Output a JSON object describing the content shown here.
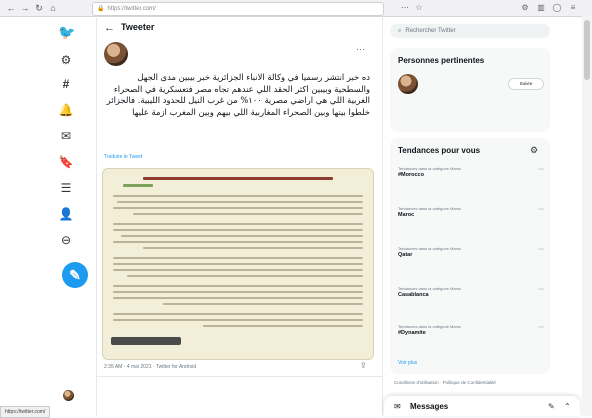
{
  "browser": {
    "url": "https://twitter.com/",
    "status_url": "https://twitter.com/"
  },
  "nav": {
    "items": [
      {
        "name": "twitter-logo-icon",
        "glyph": "🐦"
      },
      {
        "name": "settings-icon",
        "glyph": "⚙"
      },
      {
        "name": "explore-hashtag-icon",
        "glyph": "#"
      },
      {
        "name": "notifications-icon",
        "glyph": "🔔"
      },
      {
        "name": "messages-icon",
        "glyph": "✉"
      },
      {
        "name": "bookmarks-icon",
        "glyph": "🔖"
      },
      {
        "name": "lists-icon",
        "glyph": "☰"
      },
      {
        "name": "profile-icon",
        "glyph": "👤"
      },
      {
        "name": "more-icon",
        "glyph": "⊖"
      }
    ],
    "compose_glyph": "✎"
  },
  "header": {
    "back": "←",
    "title": "Tweeter"
  },
  "tweet": {
    "author_name": "",
    "author_handle": "",
    "text": "ده خبر انتشر رسميا في وكالة الانباء الجزائرية خبر بيبين مدى الجهل والسطحية وبيبين اكثر الحقد اللي عندهم تجاه مصر فتعسكرية في الصحراء الغربية اللي هي اراضي مصرية ١٠٠% من غرب النيل للحدود الليبية. فالجزائر خلطوا بينها وبين الصحراء المغاربية اللي بيهم وبين المغرب ازمة عليها",
    "translate_label": "Traduire le Tweet",
    "timestamp": "2:35 AM · 4 mai 2021 · Twitter for Android",
    "stats": {
      "retweets": "",
      "quotes": "",
      "likes": ""
    }
  },
  "right": {
    "search_placeholder": "Rechercher Twitter",
    "relevant_title": "Personnes pertinentes",
    "relevant_name": "",
    "relevant_handle": "",
    "follow_label": "Suivre",
    "relevant_bio": "",
    "trends_title": "Tendances pour vous",
    "trends": [
      {
        "category": "Tendances dans la catégorie Maroc",
        "name": "#Morocco",
        "count": ""
      },
      {
        "category": "Tendances dans la catégorie Maroc",
        "name": "Maroc",
        "count": ""
      },
      {
        "category": "Tendances dans la catégorie Maroc",
        "name": "Qatar",
        "count": ""
      },
      {
        "category": "Tendances dans la catégorie Maroc",
        "name": "Casablanca",
        "count": ""
      },
      {
        "category": "Tendances dans la catégorie Maroc",
        "name": "#Dynamite",
        "count": ""
      }
    ],
    "show_more": "Voir plus",
    "footer": "Conditions d'utilisation · Politique de Confidentialité",
    "messages_label": "Messages"
  },
  "colors": {
    "accent": "#1d9bf0"
  }
}
